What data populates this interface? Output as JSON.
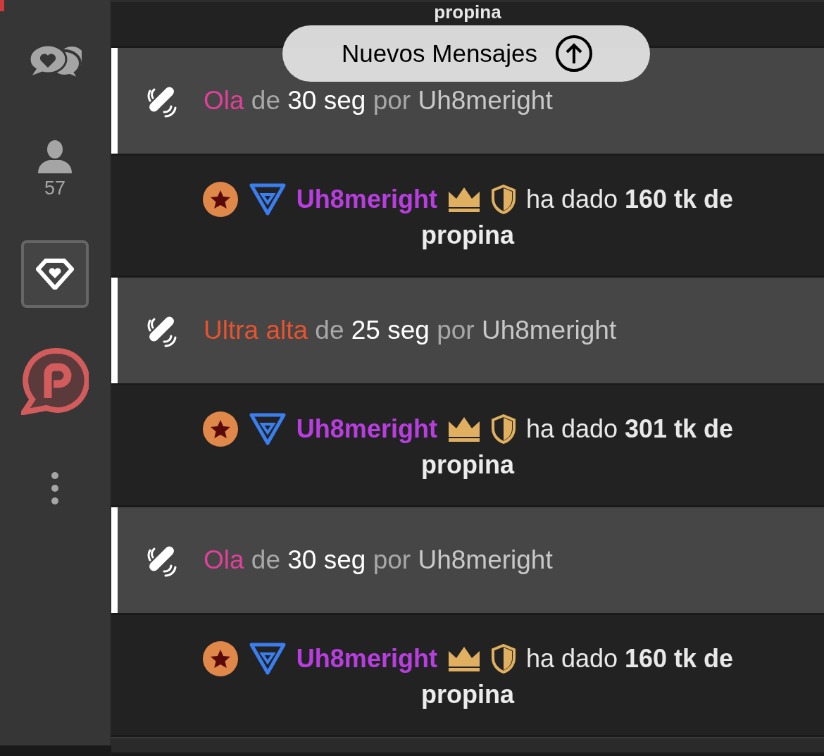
{
  "sidebar": {
    "items": [
      {
        "kind": "chat",
        "selected": false
      },
      {
        "kind": "users",
        "count": "57",
        "selected": false
      },
      {
        "kind": "diamond",
        "selected": true
      },
      {
        "kind": "logo",
        "selected": false
      },
      {
        "kind": "more",
        "selected": false
      }
    ]
  },
  "messages": [
    {
      "kind": "tip_cut",
      "text": "propina"
    },
    {
      "kind": "notice",
      "type": "Ola",
      "color": "#e0409a",
      "de": "de",
      "duration": "30 seg",
      "por": "por",
      "user": "Uh8meright"
    },
    {
      "kind": "tip",
      "user": "Uh8meright",
      "text": "ha dado **160 tk de**",
      "text_cont": "propina"
    },
    {
      "kind": "notice",
      "type": "Ultra alta",
      "color": "#e8532f",
      "de": "de",
      "duration": "25 seg",
      "por": "por",
      "user": "Uh8meright"
    },
    {
      "kind": "tip",
      "user": "Uh8meright",
      "text": "ha dado **301 tk de**",
      "text_cont": "propina"
    },
    {
      "kind": "notice",
      "type": "Ola",
      "color": "#e0409a",
      "de": "de",
      "duration": "30 seg",
      "por": "por",
      "user": "Uh8meright"
    },
    {
      "kind": "tip",
      "user": "Uh8meright",
      "text": "ha dado **160 tk de**",
      "text_cont": "propina"
    }
  ],
  "new_messages": {
    "label": "Nuevos Mensajes"
  }
}
